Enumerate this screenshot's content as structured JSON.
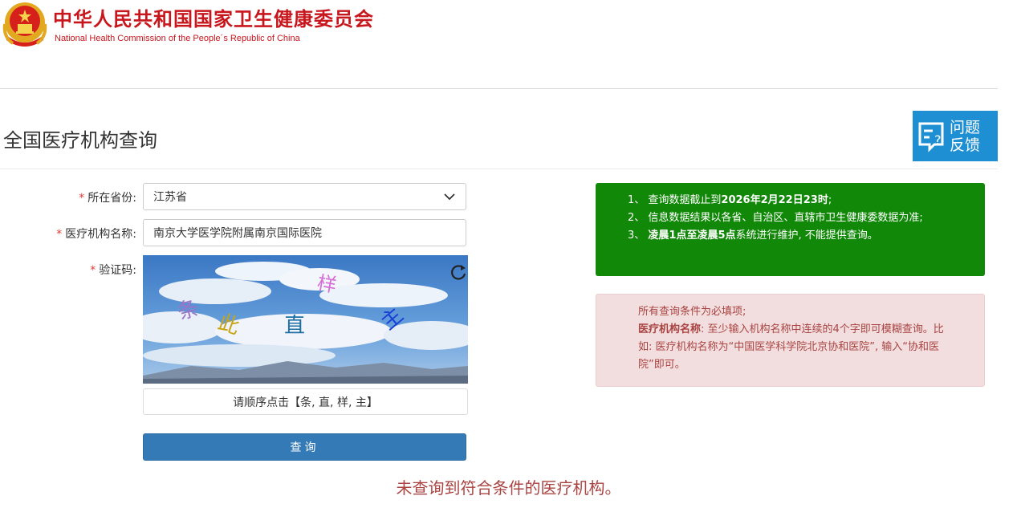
{
  "header": {
    "title_cn": "中华人民共和国国家卫生健康委员会",
    "title_en": "National Health Commission of the People´s Republic of China"
  },
  "page": {
    "title": "全国医疗机构查询",
    "feedback_line1": "问题",
    "feedback_line2": "反馈"
  },
  "form": {
    "star": "*",
    "province_label": "所在省份:",
    "province_value": "江苏省",
    "institution_label": "医疗机构名称:",
    "institution_value": "南京大学医学院附属南京国际医院",
    "captcha_label": "验证码:",
    "captcha_chars": [
      "条",
      "此",
      "直",
      "样",
      "主"
    ],
    "captcha_hint": "请顺序点击【条, 直, 样, 主】",
    "query_button": "查询"
  },
  "result": {
    "message": "未查询到符合条件的医疗机构。"
  },
  "notice_green": {
    "line1_prefix": "1、 查询数据截止到",
    "line1_bold": "2026年2月22日23时",
    "line1_suffix": ";",
    "line2": "2、 信息数据结果以各省、自治区、直辖市卫生健康委数据为准;",
    "line3_prefix": "3、 ",
    "line3_bold": "凌晨1点至凌晨5点",
    "line3_suffix": "系统进行维护, 不能提供查询。"
  },
  "notice_red": {
    "line1": "所有查询条件为必填项;",
    "line2_bold": "医疗机构名称",
    "line2_rest": ": 至少输入机构名称中连续的4个字即可模糊查询。比如: 医疗机构名称为“中国医学科学院北京协和医院”, 输入“协和医院”即可。"
  },
  "colors": {
    "brand_red": "#c8161d",
    "feedback_blue": "#1f8fd4",
    "notice_green": "#118808",
    "button_blue": "#337ab7",
    "error_red": "#a94442"
  }
}
